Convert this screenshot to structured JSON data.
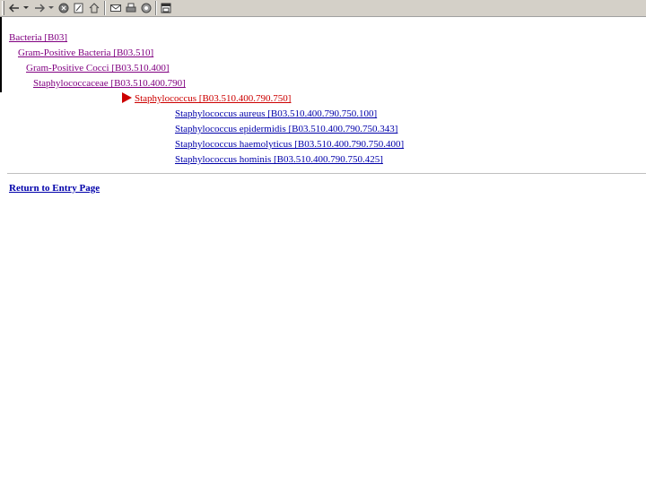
{
  "toolbar": {
    "back_icon": "back-arrow-icon",
    "forward_icon": "forward-arrow-icon",
    "stop_icon": "stop-icon",
    "refresh_icon": "refresh-icon",
    "home_icon": "home-icon",
    "mail_icon": "mail-icon",
    "print_icon": "print-icon",
    "discuss_icon": "discuss-icon",
    "window_icon": "window-icon"
  },
  "tree": {
    "root": "Bacteria [B03]",
    "level1": "Gram-Positive Bacteria [B03.510]",
    "level2": "Gram-Positive Cocci [B03.510.400]",
    "level3": "Staphylococcaceae [B03.510.400.790]",
    "current": "Staphylococcus [B03.510.400.790.750]",
    "children": [
      "Staphylococcus aureus [B03.510.400.790.750.100]",
      "Staphylococcus epidermidis [B03.510.400.790.750.343]",
      "Staphylococcus haemolyticus [B03.510.400.790.750.400]",
      "Staphylococcus hominis [B03.510.400.790.750.425]"
    ]
  },
  "return_link": "Return to Entry Page",
  "colors": {
    "visited": "#800080",
    "link": "#0000aa",
    "current": "#cc0000"
  }
}
